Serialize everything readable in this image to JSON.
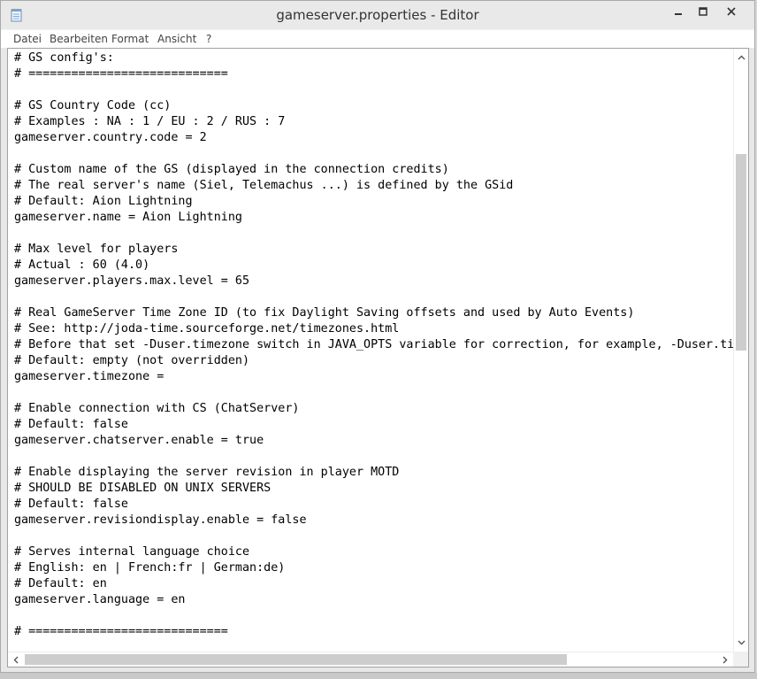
{
  "window": {
    "title": "gameserver.properties - Editor"
  },
  "menu": {
    "items": [
      "Datei",
      "Bearbeiten",
      "Format",
      "Ansicht",
      "?"
    ]
  },
  "editor": {
    "lines": [
      "# GS config's:",
      "# ============================",
      "",
      "# GS Country Code (cc)",
      "# Examples : NA : 1 / EU : 2 / RUS : 7",
      "gameserver.country.code = 2",
      "",
      "# Custom name of the GS (displayed in the connection credits)",
      "# The real server's name (Siel, Telemachus ...) is defined by the GSid",
      "# Default: Aion Lightning",
      "gameserver.name = Aion Lightning",
      "",
      "# Max level for players",
      "# Actual : 60 (4.0)",
      "gameserver.players.max.level = 65",
      "",
      "# Real GameServer Time Zone ID (to fix Daylight Saving offsets and used by Auto Events)",
      "# See: http://joda-time.sourceforge.net/timezones.html",
      "# Before that set -Duser.timezone switch in JAVA_OPTS variable for correction, for example, -Duser.ti",
      "# Default: empty (not overridden)",
      "gameserver.timezone =",
      "",
      "# Enable connection with CS (ChatServer)",
      "# Default: false",
      "gameserver.chatserver.enable = true",
      "",
      "# Enable displaying the server revision in player MOTD",
      "# SHOULD BE DISABLED ON UNIX SERVERS",
      "# Default: false",
      "gameserver.revisiondisplay.enable = false",
      "",
      "# Serves internal language choice",
      "# English: en | French:fr | German:de)",
      "# Default: en",
      "gameserver.language = en",
      "",
      "# ============================"
    ]
  },
  "icons": {
    "app": "notepad-icon",
    "minimize": "minimize-icon",
    "maximize": "maximize-icon",
    "close": "close-icon"
  },
  "colors": {
    "titlebar": "#e9e9e9",
    "scroll_thumb": "#cdcdcd",
    "text": "#000000"
  }
}
